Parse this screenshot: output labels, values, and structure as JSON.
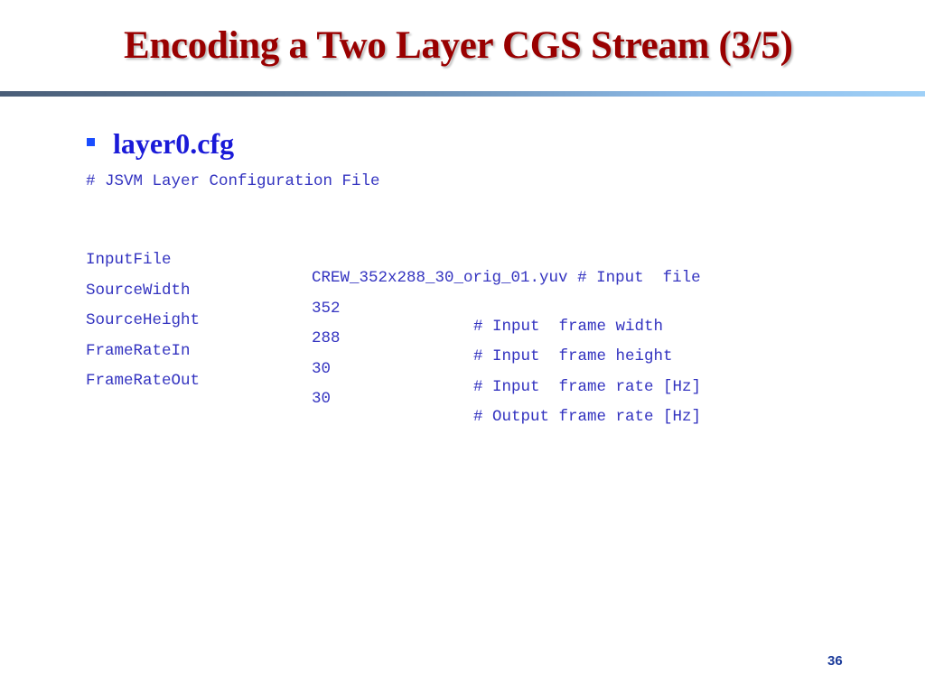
{
  "slide": {
    "title": "Encoding a Two Layer CGS Stream (3/5)",
    "page_number": "36"
  },
  "colors": {
    "title": "#990000",
    "bullet": "#1a4dff",
    "bullet_text": "#1a1ad8",
    "code_text": "#3333c0",
    "page_number": "#1a3a9a"
  },
  "bullet": {
    "icon": "square-bullet-icon",
    "label": "layer0.cfg"
  },
  "config": {
    "header_comment": "# JSVM Layer Configuration File",
    "rows": [
      {
        "key": "InputFile",
        "value": "CREW_352x288_30_orig_01.yuv",
        "comment": "# Input  file"
      },
      {
        "key": "SourceWidth",
        "value": "352",
        "comment": "# Input  frame width"
      },
      {
        "key": "SourceHeight",
        "value": "288",
        "comment": "# Input  frame height"
      },
      {
        "key": "FrameRateIn",
        "value": "30",
        "comment": "# Input  frame rate [Hz]"
      },
      {
        "key": "FrameRateOut",
        "value": "30",
        "comment": "# Output frame rate [Hz]"
      }
    ]
  }
}
